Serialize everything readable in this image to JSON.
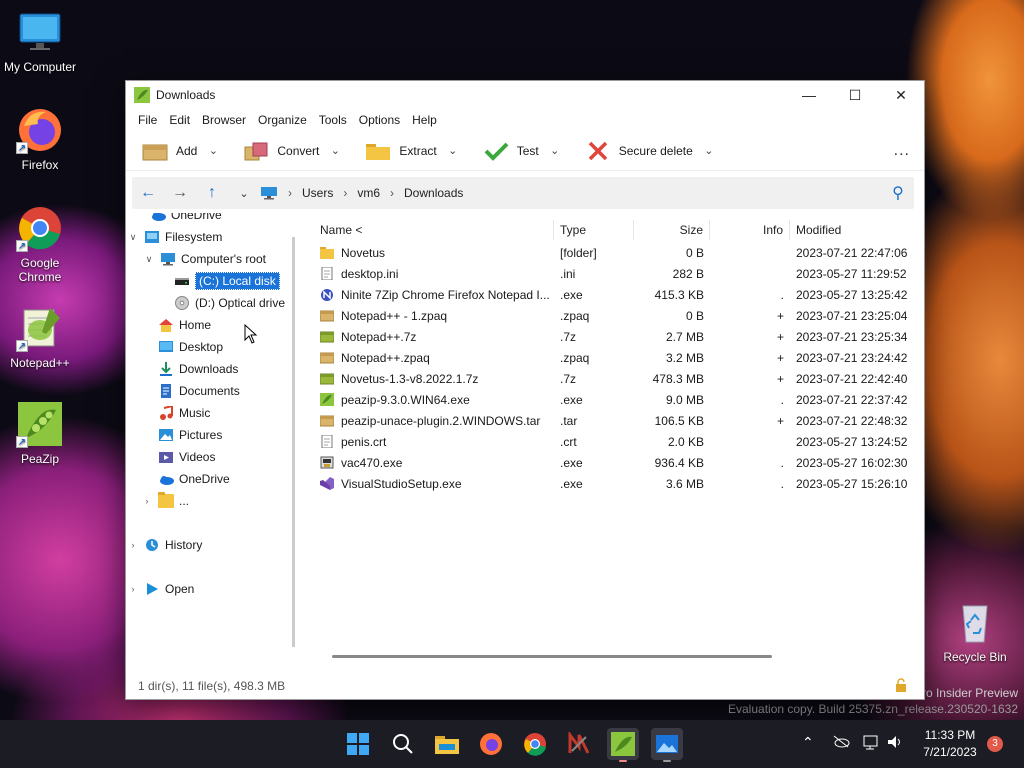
{
  "desktop": {
    "icons": [
      {
        "label": "My Computer"
      },
      {
        "label": "Firefox"
      },
      {
        "label": "Google Chrome"
      },
      {
        "label": "Notepad++"
      },
      {
        "label": "PeaZip"
      },
      {
        "label": "Recycle Bin"
      }
    ],
    "watermark": {
      "line1": "ro Insider Preview",
      "line2": "Evaluation copy. Build 25375.zn_release.230520-1632"
    }
  },
  "window": {
    "title": "Downloads",
    "menu": [
      "File",
      "Edit",
      "Browser",
      "Organize",
      "Tools",
      "Options",
      "Help"
    ],
    "toolbar": {
      "add": "Add",
      "convert": "Convert",
      "extract": "Extract",
      "test": "Test",
      "secure_delete": "Secure delete",
      "more": "..."
    },
    "address": {
      "segments": [
        "Users",
        "vm6",
        "Downloads"
      ]
    },
    "tree": {
      "onedrive_top": "OneDrive",
      "filesystem": "Filesystem",
      "computer_root": "Computer's root",
      "local_disk": "(C:) Local disk",
      "optical_drive": "(D:) Optical drive",
      "home": "Home",
      "desktop": "Desktop",
      "downloads": "Downloads",
      "documents": "Documents",
      "music": "Music",
      "pictures": "Pictures",
      "videos": "Videos",
      "onedrive": "OneDrive",
      "more": "...",
      "history": "History",
      "open": "Open"
    },
    "columns": {
      "name": "Name <",
      "type": "Type",
      "size": "Size",
      "info": "Info",
      "modified": "Modified"
    },
    "files": [
      {
        "name": "Novetus",
        "type": "[folder]",
        "size": "0 B",
        "info": "",
        "modified": "2023-07-21 22:47:06",
        "icon": "folder"
      },
      {
        "name": "desktop.ini",
        "type": ".ini",
        "size": "282 B",
        "info": "",
        "modified": "2023-05-27 11:29:52",
        "icon": "doc"
      },
      {
        "name": "Ninite 7Zip Chrome Firefox Notepad I...",
        "type": ".exe",
        "size": "415.3 KB",
        "info": ".",
        "modified": "2023-05-27 13:25:42",
        "icon": "ninite"
      },
      {
        "name": "Notepad++ - 1.zpaq",
        "type": ".zpaq",
        "size": "0 B",
        "info": "+",
        "modified": "2023-07-21 23:25:04",
        "icon": "archive-tan"
      },
      {
        "name": "Notepad++.7z",
        "type": ".7z",
        "size": "2.7 MB",
        "info": "+",
        "modified": "2023-07-21 23:25:34",
        "icon": "archive"
      },
      {
        "name": "Notepad++.zpaq",
        "type": ".zpaq",
        "size": "3.2 MB",
        "info": "+",
        "modified": "2023-07-21 23:24:42",
        "icon": "archive-tan"
      },
      {
        "name": "Novetus-1.3-v8.2022.1.7z",
        "type": ".7z",
        "size": "478.3 MB",
        "info": "+",
        "modified": "2023-07-21 22:42:40",
        "icon": "archive"
      },
      {
        "name": "peazip-9.3.0.WIN64.exe",
        "type": ".exe",
        "size": "9.0 MB",
        "info": ".",
        "modified": "2023-07-21 22:37:42",
        "icon": "peazip"
      },
      {
        "name": "peazip-unace-plugin.2.WINDOWS.tar",
        "type": ".tar",
        "size": "106.5 KB",
        "info": "+",
        "modified": "2023-07-21 22:48:32",
        "icon": "archive-tan"
      },
      {
        "name": "penis.crt",
        "type": ".crt",
        "size": "2.0 KB",
        "info": "",
        "modified": "2023-05-27 13:24:52",
        "icon": "doc"
      },
      {
        "name": "vac470.exe",
        "type": ".exe",
        "size": "936.4 KB",
        "info": ".",
        "modified": "2023-05-27 16:02:30",
        "icon": "vac"
      },
      {
        "name": "VisualStudioSetup.exe",
        "type": ".exe",
        "size": "3.6 MB",
        "info": ".",
        "modified": "2023-05-27 15:26:10",
        "icon": "vs"
      }
    ],
    "status": "1 dir(s), 11 file(s), 498.3 MB"
  },
  "taskbar": {
    "time": "11:33 PM",
    "date": "7/21/2023",
    "notification_count": "3"
  }
}
